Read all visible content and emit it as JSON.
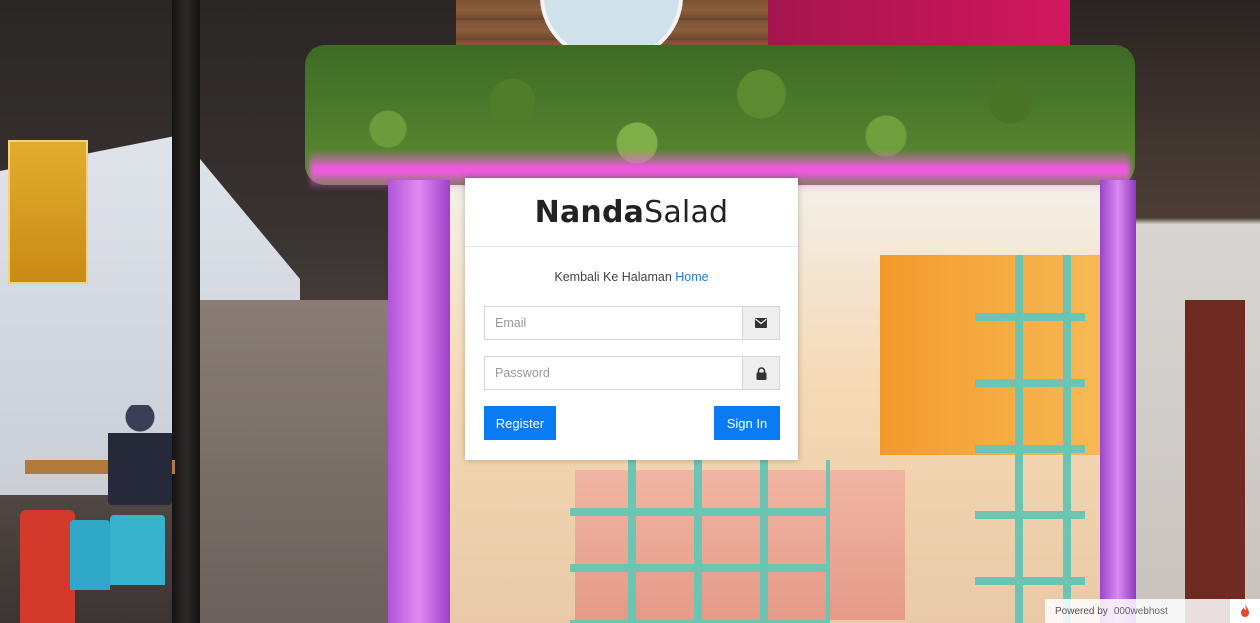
{
  "brand": {
    "bold": "Nanda",
    "regular": "Salad"
  },
  "back_link": {
    "prefix": "Kembali Ke Halaman",
    "link_label": "Home"
  },
  "form": {
    "email_placeholder": "Email",
    "email_value": "",
    "password_placeholder": "Password",
    "password_value": "",
    "email_icon": "envelope-icon",
    "password_icon": "lock-icon"
  },
  "buttons": {
    "register": "Register",
    "sign_in": "Sign In"
  },
  "footer": {
    "powered_by": "Powered by",
    "host": "000webhost",
    "icon": "flame-icon"
  },
  "colors": {
    "primary": "#0a7bf2",
    "link": "#1e7dd8"
  }
}
